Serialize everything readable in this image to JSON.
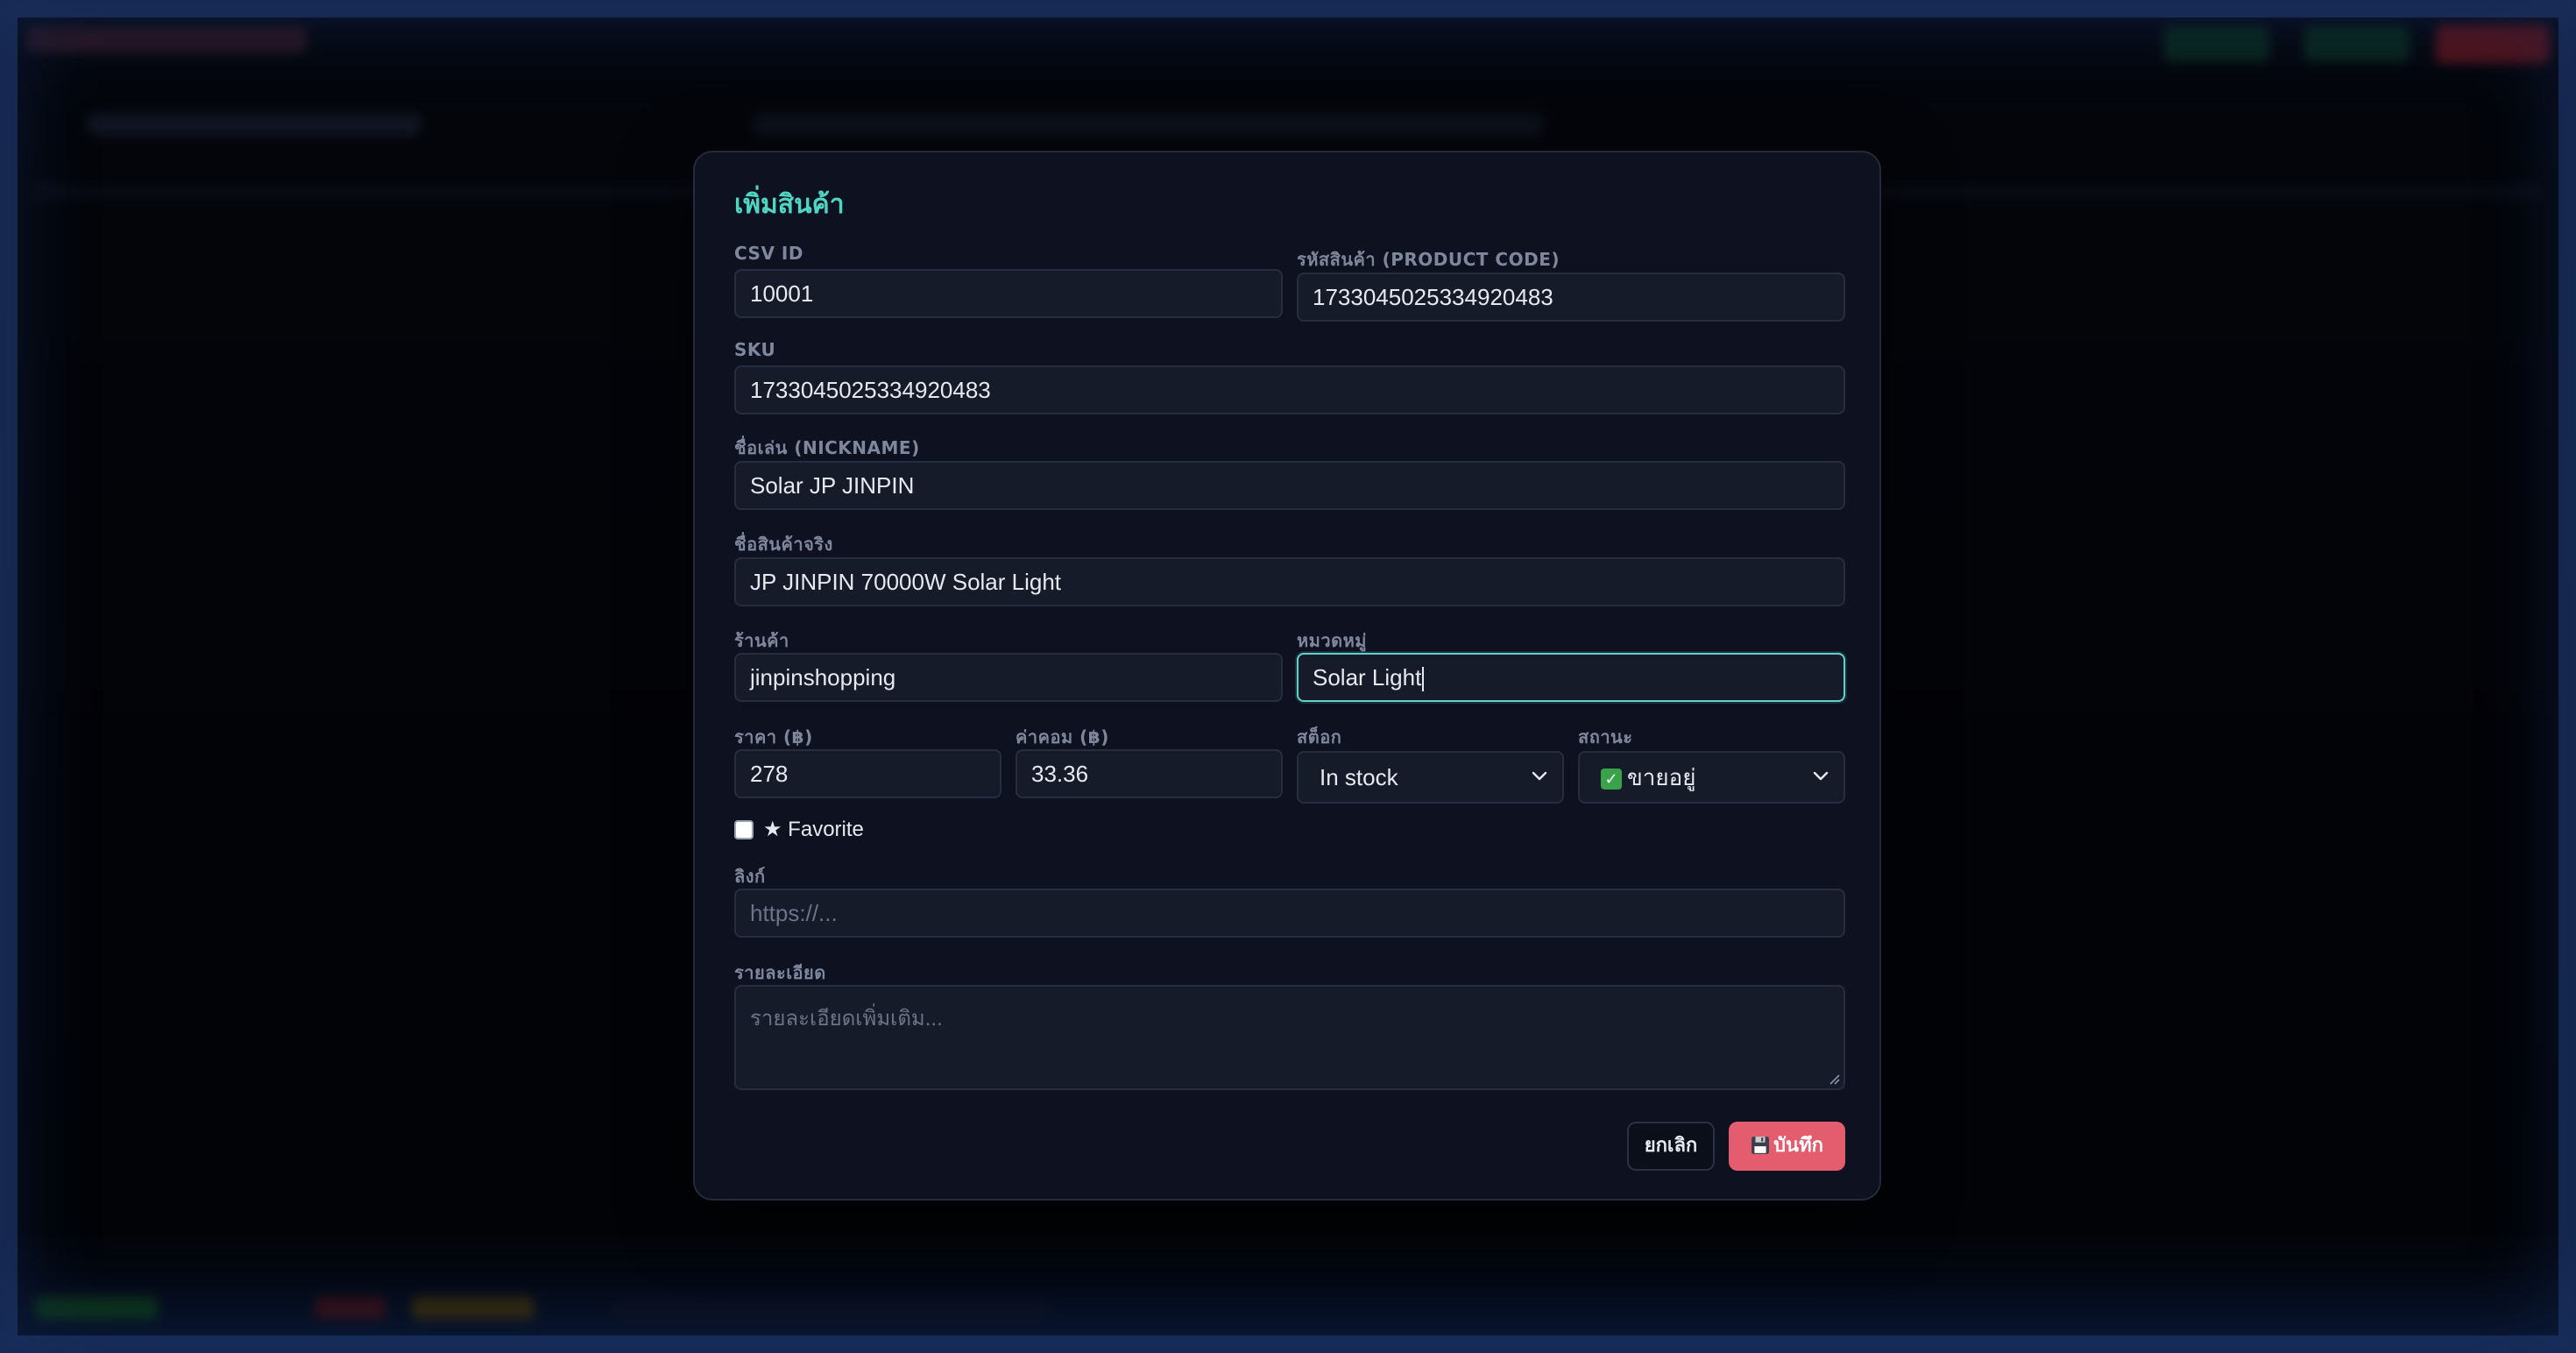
{
  "modal": {
    "title": "เพิ่มสินค้า",
    "csv_id": {
      "label": "CSV ID",
      "value": "10001"
    },
    "product_code": {
      "label": "รหัสสินค้า (PRODUCT CODE)",
      "value": "1733045025334920483"
    },
    "sku": {
      "label": "SKU",
      "value": "1733045025334920483"
    },
    "nickname": {
      "label": "ชื่อเล่น (NICKNAME)",
      "value": "Solar JP JINPIN"
    },
    "real_name": {
      "label": "ชื่อสินค้าจริง",
      "value": "JP JINPIN 70000W Solar Light"
    },
    "shop": {
      "label": "ร้านค้า",
      "value": "jinpinshopping"
    },
    "category": {
      "label": "หมวดหมู่",
      "value": "Solar Light"
    },
    "price": {
      "label": "ราคา (฿)",
      "value": "278"
    },
    "commission": {
      "label": "ค่าคอม (฿)",
      "value": "33.36"
    },
    "stock": {
      "label": "สต็อก",
      "value": "In stock"
    },
    "status": {
      "label": "สถานะ",
      "icon": "check-mark-emoji",
      "value": "ขายอยู่"
    },
    "favorite": {
      "label": "★ Favorite",
      "checked": false
    },
    "link": {
      "label": "ลิงก์",
      "placeholder": "https://..."
    },
    "details": {
      "label": "รายละเอียด",
      "placeholder": "รายละเอียดเพิ่มเติม..."
    },
    "cancel_label": "ยกเลิก",
    "save_label": "บันทึก",
    "save_icon": "floppy-disk-icon"
  },
  "colors": {
    "accent_title": "#4fd6c3",
    "focus_border": "#62d2c9",
    "save_button": "#e35d6e",
    "modal_bg": "#0e1220",
    "field_bg": "#161b2a"
  }
}
